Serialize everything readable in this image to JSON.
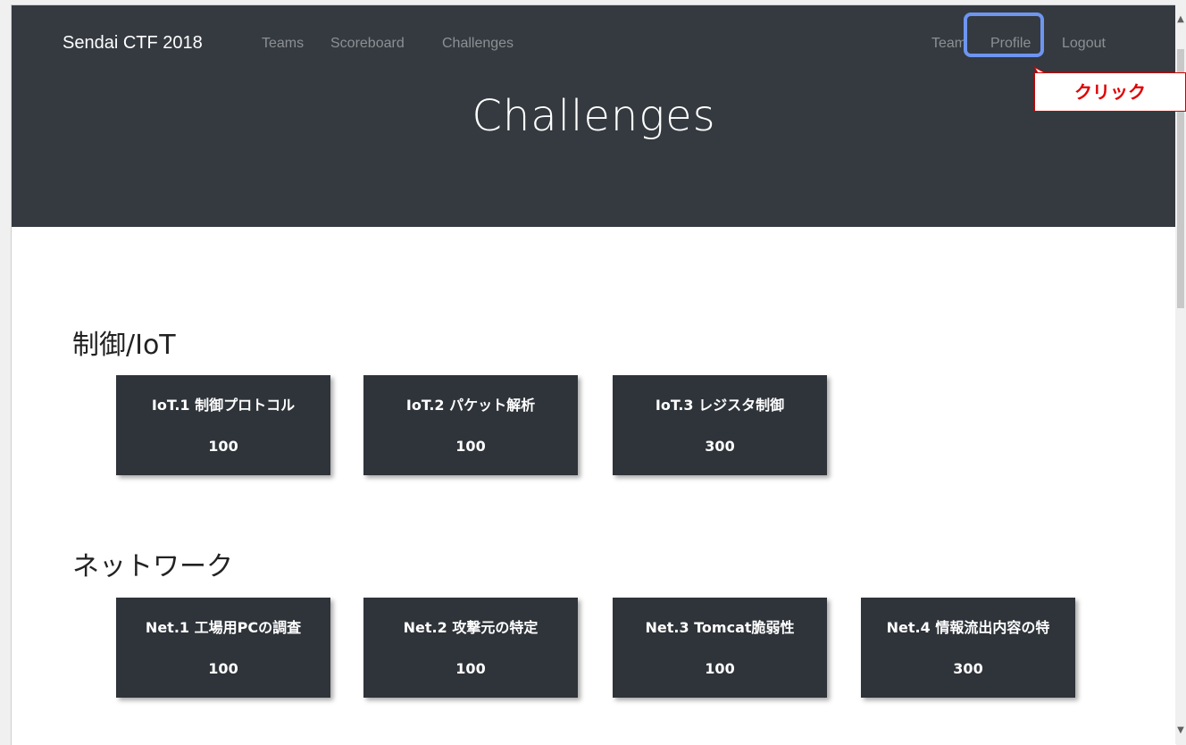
{
  "navbar": {
    "brand": "Sendai CTF 2018",
    "left_links": [
      "Teams",
      "Scoreboard",
      "Challenges"
    ],
    "right_links": [
      "Team",
      "Profile",
      "Logout"
    ]
  },
  "page": {
    "title": "Challenges"
  },
  "annotation": {
    "callout_text": "クリック",
    "highlight_color": "#6e95f0",
    "callout_color": "#e00000"
  },
  "sections": [
    {
      "heading": "制御/IoT",
      "challenges": [
        {
          "name": "IoT.1 制御プロトコル",
          "value": "100"
        },
        {
          "name": "IoT.2 パケット解析",
          "value": "100"
        },
        {
          "name": "IoT.3 レジスタ制御",
          "value": "300"
        }
      ]
    },
    {
      "heading": "ネットワーク",
      "challenges": [
        {
          "name": "Net.1 工場用PCの調査",
          "value": "100"
        },
        {
          "name": "Net.2 攻撃元の特定",
          "value": "100"
        },
        {
          "name": "Net.3 Tomcat脆弱性",
          "value": "100"
        },
        {
          "name": "Net.4 情報流出内容の特",
          "value": "300"
        }
      ]
    }
  ],
  "colors": {
    "header_bg": "#343a40",
    "card_bg": "#2f343a"
  }
}
